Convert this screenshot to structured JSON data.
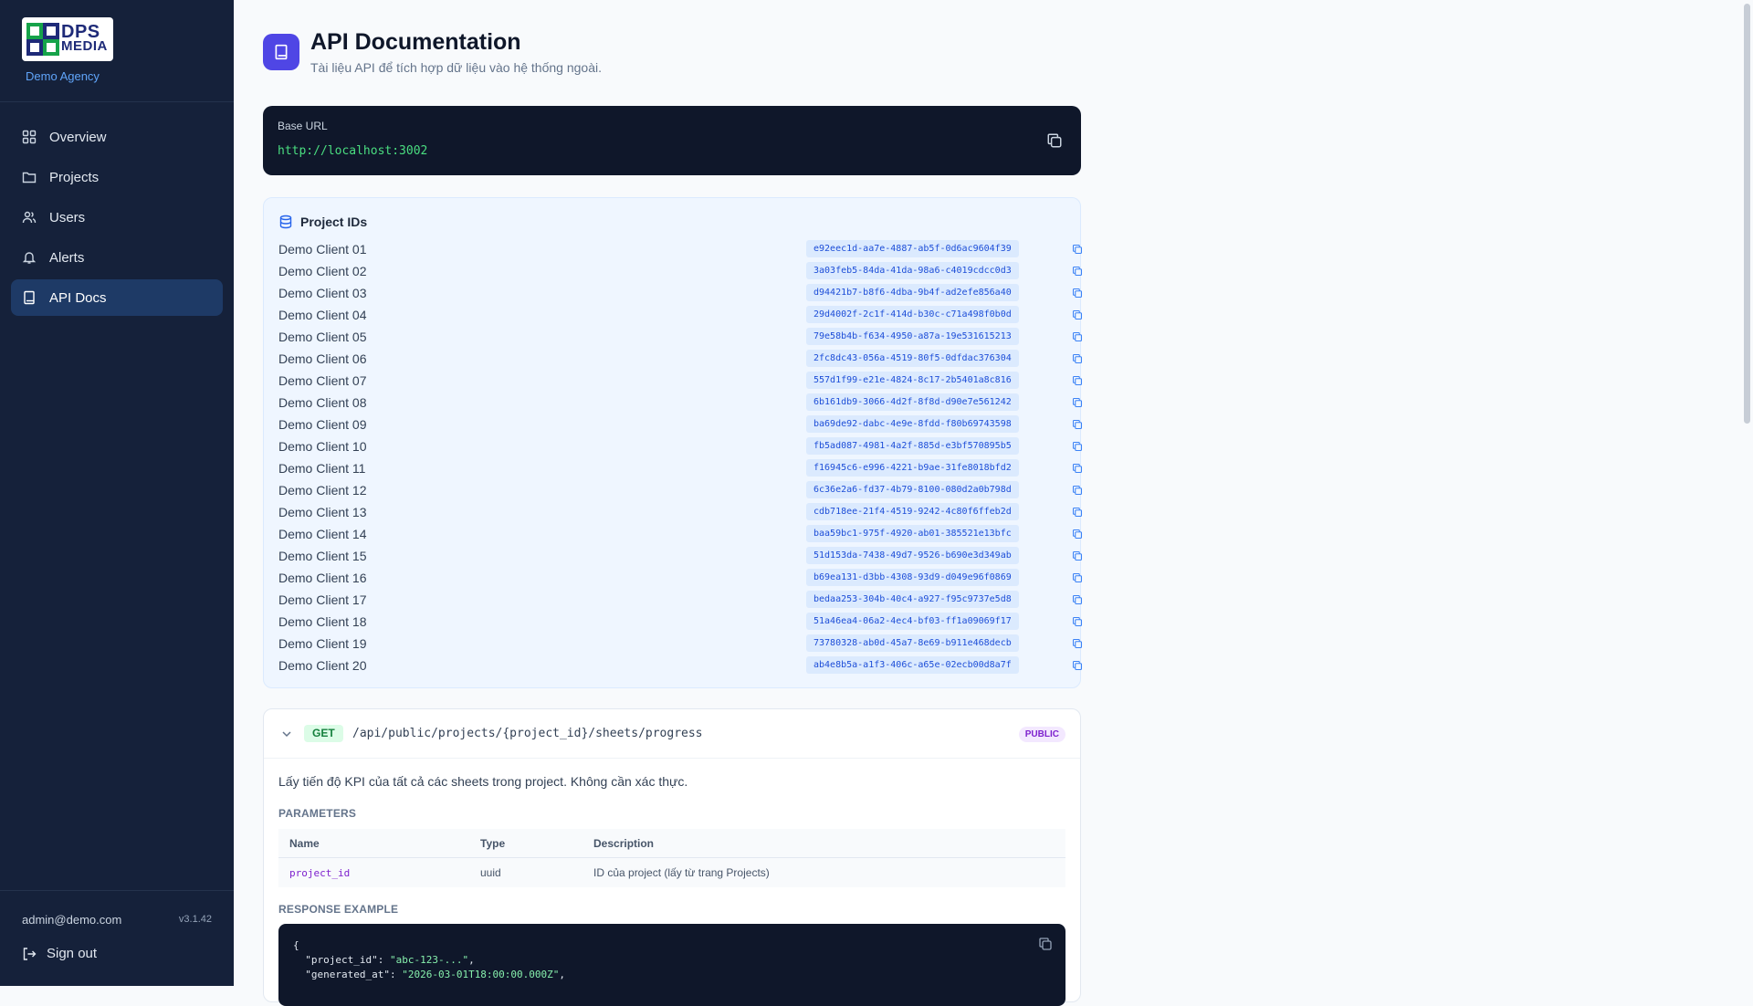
{
  "sidebar": {
    "logo_line1": "DPS",
    "logo_line2": "MEDIA",
    "agency": "Demo Agency",
    "items": [
      {
        "label": "Overview",
        "icon": "grid-icon"
      },
      {
        "label": "Projects",
        "icon": "folder-icon"
      },
      {
        "label": "Users",
        "icon": "users-icon"
      },
      {
        "label": "Alerts",
        "icon": "bell-icon"
      },
      {
        "label": "API Docs",
        "icon": "book-icon",
        "active": true
      }
    ],
    "email": "admin@demo.com",
    "version": "v3.1.42",
    "signout": "Sign out"
  },
  "header": {
    "title": "API Documentation",
    "subtitle": "Tài liệu API để tích hợp dữ liệu vào hệ thống ngoài."
  },
  "base": {
    "label": "Base URL",
    "url": "http://localhost:3002"
  },
  "project_ids": {
    "title": "Project IDs",
    "items": [
      {
        "name": "Demo Client 01",
        "id": "e92eec1d-aa7e-4887-ab5f-0d6ac9604f39"
      },
      {
        "name": "Demo Client 02",
        "id": "3a03feb5-84da-41da-98a6-c4019cdcc0d3"
      },
      {
        "name": "Demo Client 03",
        "id": "d94421b7-b8f6-4dba-9b4f-ad2efe856a40"
      },
      {
        "name": "Demo Client 04",
        "id": "29d4002f-2c1f-414d-b30c-c71a498f0b0d"
      },
      {
        "name": "Demo Client 05",
        "id": "79e58b4b-f634-4950-a87a-19e531615213"
      },
      {
        "name": "Demo Client 06",
        "id": "2fc8dc43-056a-4519-80f5-0dfdac376304"
      },
      {
        "name": "Demo Client 07",
        "id": "557d1f99-e21e-4824-8c17-2b5401a8c816"
      },
      {
        "name": "Demo Client 08",
        "id": "6b161db9-3066-4d2f-8f8d-d90e7e561242"
      },
      {
        "name": "Demo Client 09",
        "id": "ba69de92-dabc-4e9e-8fdd-f80b69743598"
      },
      {
        "name": "Demo Client 10",
        "id": "fb5ad087-4981-4a2f-885d-e3bf570895b5"
      },
      {
        "name": "Demo Client 11",
        "id": "f16945c6-e996-4221-b9ae-31fe8018bfd2"
      },
      {
        "name": "Demo Client 12",
        "id": "6c36e2a6-fd37-4b79-8100-080d2a0b798d"
      },
      {
        "name": "Demo Client 13",
        "id": "cdb718ee-21f4-4519-9242-4c80f6ffeb2d"
      },
      {
        "name": "Demo Client 14",
        "id": "baa59bc1-975f-4920-ab01-385521e13bfc"
      },
      {
        "name": "Demo Client 15",
        "id": "51d153da-7438-49d7-9526-b690e3d349ab"
      },
      {
        "name": "Demo Client 16",
        "id": "b69ea131-d3bb-4308-93d9-d049e96f0869"
      },
      {
        "name": "Demo Client 17",
        "id": "bedaa253-304b-40c4-a927-f95c9737e5d8"
      },
      {
        "name": "Demo Client 18",
        "id": "51a46ea4-06a2-4ec4-bf03-ff1a09069f17"
      },
      {
        "name": "Demo Client 19",
        "id": "73780328-ab0d-45a7-8e69-b911e468decb"
      },
      {
        "name": "Demo Client 20",
        "id": "ab4e8b5a-a1f3-406c-a65e-02ecb00d8a7f"
      }
    ]
  },
  "endpoint": {
    "method": "GET",
    "path": "/api/public/projects/{project_id}/sheets/progress",
    "badge": "PUBLIC",
    "description": "Lấy tiến độ KPI của tất cả các sheets trong project. Không cần xác thực.",
    "params_label": "PARAMETERS",
    "columns": [
      "Name",
      "Type",
      "Description"
    ],
    "params": [
      {
        "name": "project_id",
        "type": "uuid",
        "description": "ID của project (lấy từ trang Projects)"
      }
    ],
    "response_label": "RESPONSE EXAMPLE",
    "code": {
      "open": "{",
      "k1": "\"project_id\"",
      "v1": "\"abc-123-...\"",
      "k2": "\"generated_at\"",
      "v2": "\"2026-03-01T18:00:00.000Z\""
    }
  },
  "colors": {
    "sidebar_bg": "#15213a",
    "active_nav": "#1e3a66",
    "accent": "#4f46e5",
    "code_bg": "#0f172a",
    "url_green": "#4ade80",
    "get_green": "#15803d",
    "public_purple": "#7e22ce"
  }
}
